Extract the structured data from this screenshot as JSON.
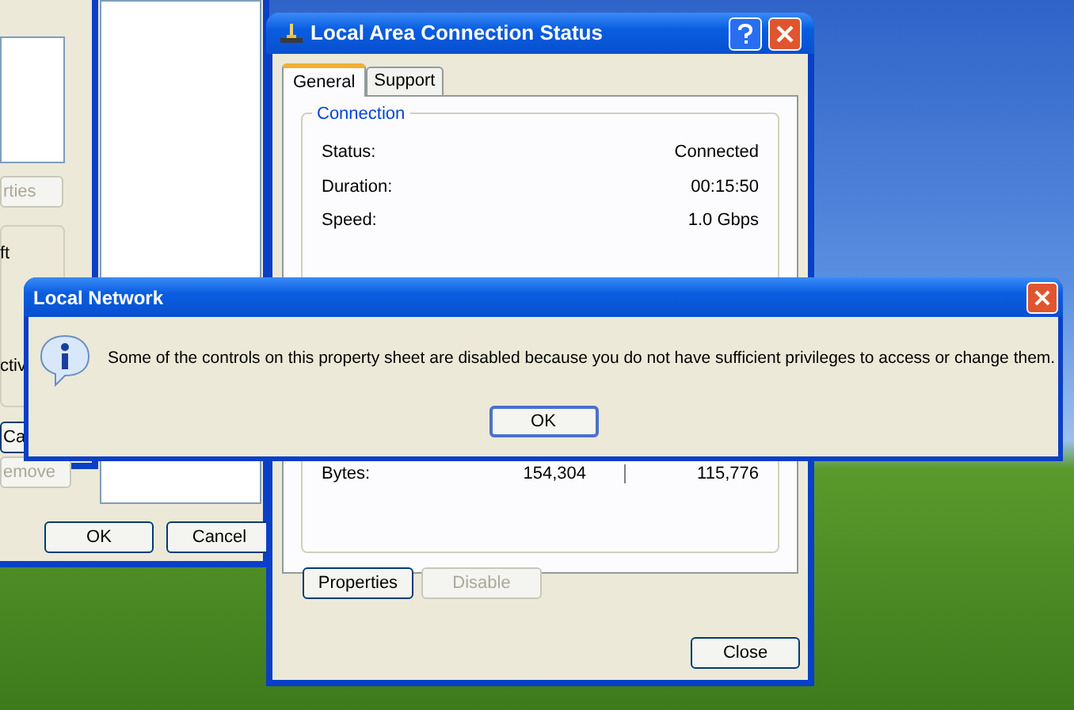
{
  "back_window": {
    "buttons": [
      {
        "label": "OK"
      },
      {
        "label": "Cancel"
      }
    ]
  },
  "property_window": {
    "items": [
      {
        "kind": "button",
        "label": "rties",
        "disabled": true
      },
      {
        "kind": "text",
        "label": "ft"
      },
      {
        "kind": "text",
        "label": "ctiv"
      },
      {
        "kind": "button",
        "label": "Ca",
        "disabled": false
      },
      {
        "kind": "button",
        "label": "emove",
        "disabled": true
      }
    ]
  },
  "status_window": {
    "title": "Local Area Connection Status",
    "tabs": [
      {
        "label": "General",
        "selected": true
      },
      {
        "label": "Support",
        "selected": false
      }
    ],
    "group": "Connection",
    "fields": [
      {
        "label": "Status:",
        "value": "Connected"
      },
      {
        "label": "Duration:",
        "value": "00:15:50"
      },
      {
        "label": "Speed:",
        "value": "1.0 Gbps"
      }
    ],
    "bytes": {
      "label": "Bytes:",
      "sent": "154,304",
      "received": "115,776"
    },
    "buttons": [
      {
        "label": "Properties",
        "disabled": false
      },
      {
        "label": "Disable",
        "disabled": true
      }
    ],
    "close": "Close"
  },
  "dialog": {
    "title": "Local Network",
    "message": "Some of the controls on this property sheet are disabled because you do not have sufficient privileges to access or change them.",
    "button": "OK"
  }
}
